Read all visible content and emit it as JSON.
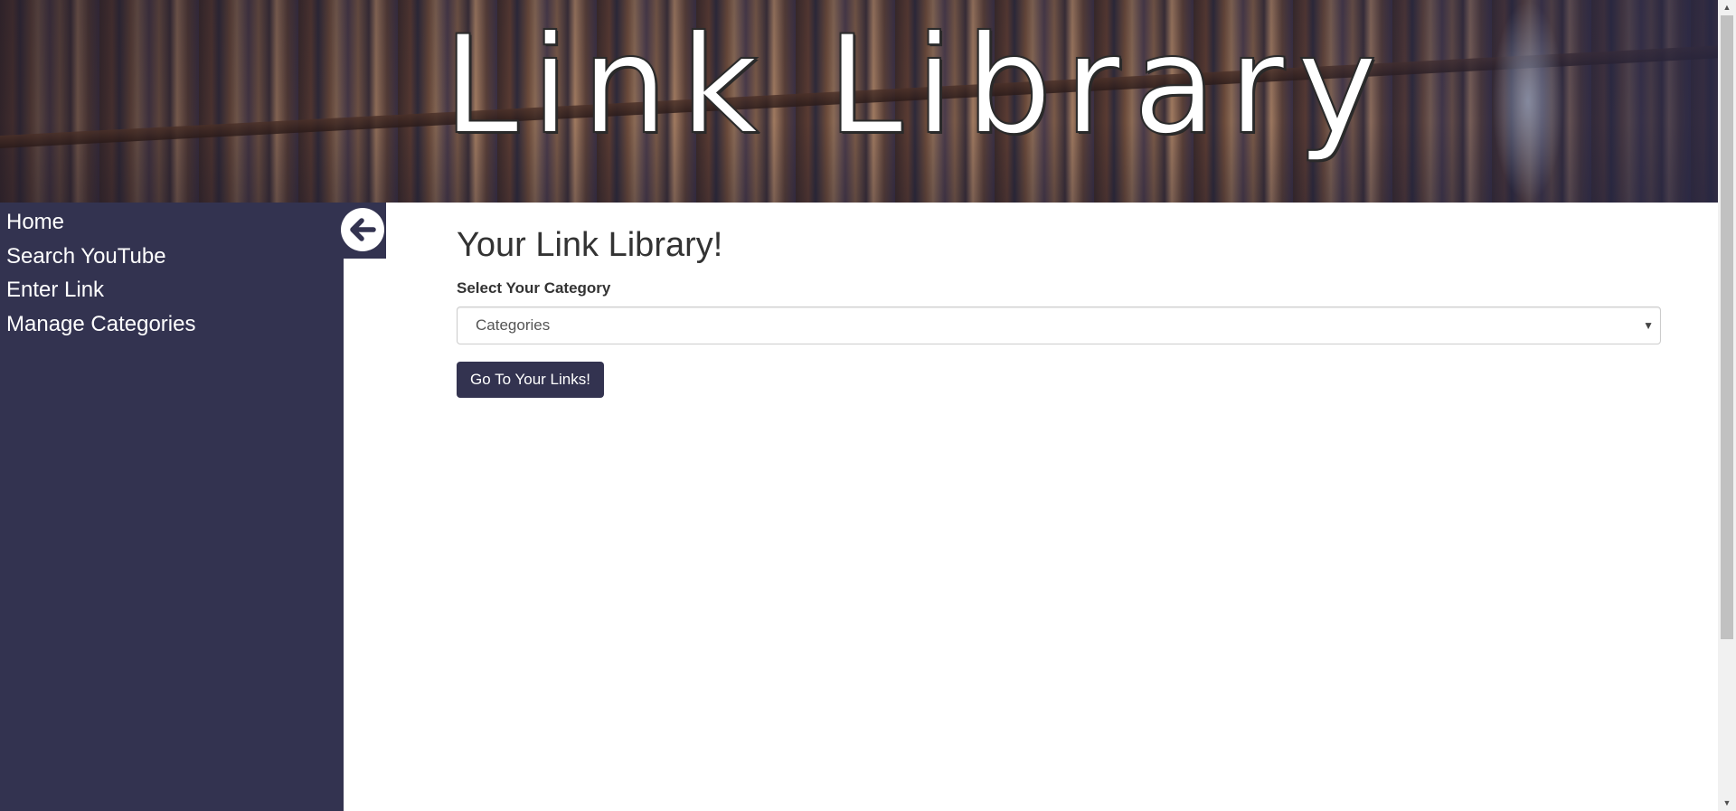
{
  "banner": {
    "title": "Link Library"
  },
  "sidebar": {
    "items": [
      {
        "label": "Home"
      },
      {
        "label": "Search YouTube"
      },
      {
        "label": "Enter Link"
      },
      {
        "label": "Manage Categories"
      }
    ],
    "toggle_icon": "arrow-left-circle-icon"
  },
  "main": {
    "title": "Your Link Library!",
    "category_label": "Select Your Category",
    "category_select": {
      "selected": "Categories",
      "caret_icon": "caret-down-icon"
    },
    "go_button_label": "Go To Your Links!"
  },
  "scrollbar": {
    "up_icon": "scroll-up-arrow-icon",
    "down_icon": "scroll-down-arrow-icon"
  },
  "colors": {
    "sidebar_bg": "#333350",
    "button_bg": "#333350",
    "text": "#333333",
    "page_bg": "#ffffff"
  }
}
